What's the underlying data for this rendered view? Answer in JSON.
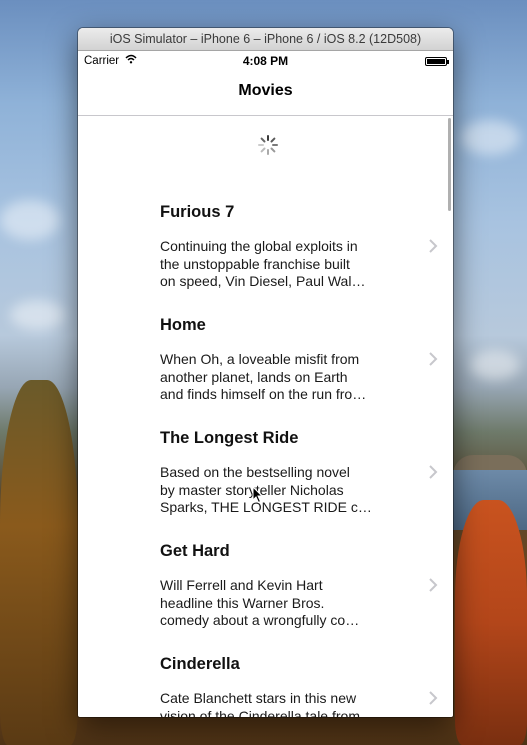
{
  "simulator": {
    "window_title": "iOS Simulator – iPhone 6 – iPhone 6 / iOS 8.2 (12D508)"
  },
  "status_bar": {
    "carrier": "Carrier",
    "time": "4:08 PM",
    "wifi_icon": "wifi-icon",
    "battery_icon": "battery-icon"
  },
  "nav": {
    "title": "Movies"
  },
  "movies": [
    {
      "title": "Furious 7",
      "lines": [
        "Continuing the global exploits in",
        "the unstoppable franchise built",
        "on speed, Vin Diesel, Paul Wal…"
      ]
    },
    {
      "title": "Home",
      "lines": [
        "When Oh, a loveable misfit from",
        "another planet, lands on Earth",
        "and finds himself on the run fro…"
      ]
    },
    {
      "title": "The Longest Ride",
      "lines": [
        "Based on the bestselling novel",
        "by master storyteller Nicholas",
        "Sparks, THE LONGEST RIDE c…"
      ]
    },
    {
      "title": "Get Hard",
      "lines": [
        "Will Ferrell and Kevin Hart",
        "headline this Warner Bros.",
        "comedy about a wrongfully co…"
      ]
    },
    {
      "title": "Cinderella",
      "lines": [
        "Cate Blanchett stars in this new",
        "vision of the Cinderella tale from",
        ""
      ]
    }
  ]
}
